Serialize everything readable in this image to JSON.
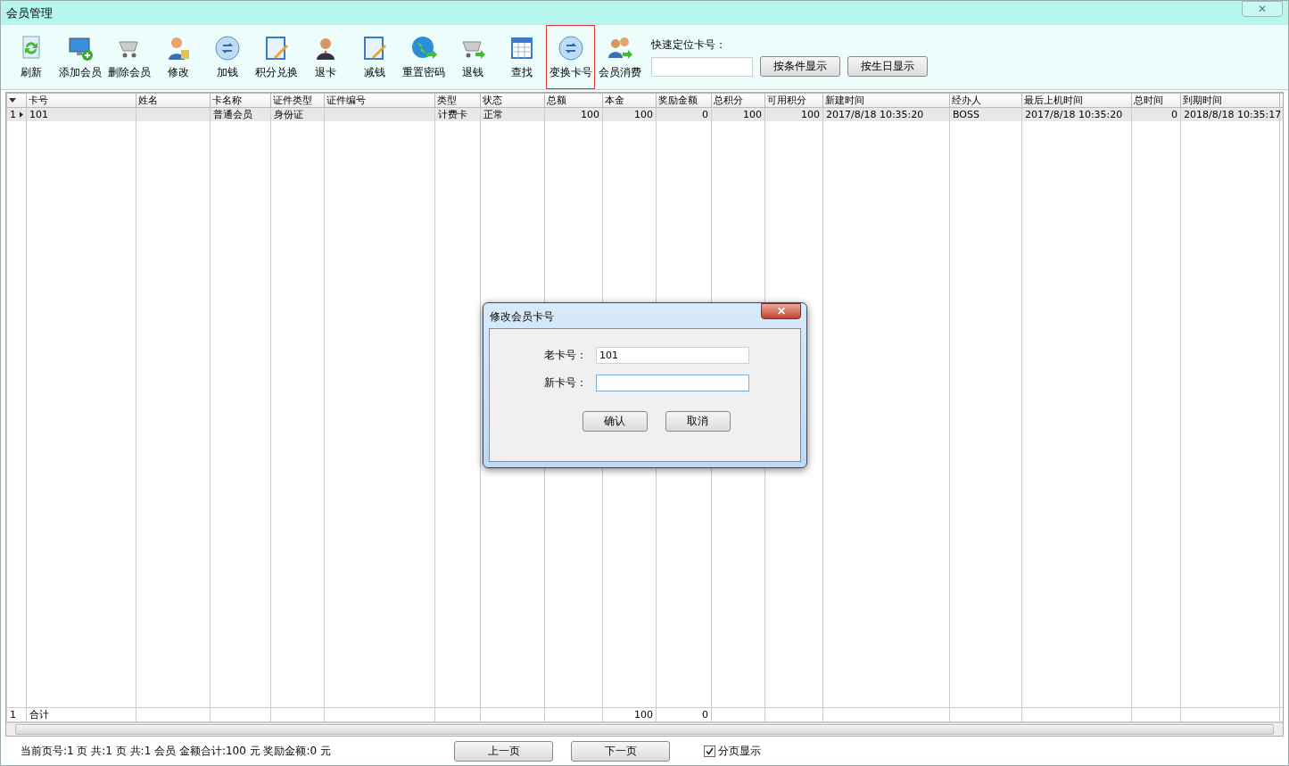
{
  "window": {
    "title": "会员管理",
    "close_label": "✕"
  },
  "toolbar": [
    {
      "label": "刷新",
      "selected": false
    },
    {
      "label": "添加会员",
      "selected": false
    },
    {
      "label": "删除会员",
      "selected": false
    },
    {
      "label": "修改",
      "selected": false
    },
    {
      "label": "加钱",
      "selected": false
    },
    {
      "label": "积分兑换",
      "selected": false
    },
    {
      "label": "退卡",
      "selected": false
    },
    {
      "label": "减钱",
      "selected": false
    },
    {
      "label": "重置密码",
      "selected": false
    },
    {
      "label": "退钱",
      "selected": false
    },
    {
      "label": "查找",
      "selected": false
    },
    {
      "label": "变换卡号",
      "selected": true
    },
    {
      "label": "会员消费",
      "selected": false
    }
  ],
  "quick_locate": {
    "label": "快速定位卡号：",
    "buttons": [
      "按条件显示",
      "按生日显示"
    ]
  },
  "table": {
    "columns": [
      {
        "label": "卡号",
        "numeric": false
      },
      {
        "label": "姓名"
      },
      {
        "label": "卡名称",
        "numeric": false
      },
      {
        "label": "证件类型",
        "numeric": false
      },
      {
        "label": "证件编号"
      },
      {
        "label": "类型",
        "numeric": false
      },
      {
        "label": "状态",
        "numeric": false
      },
      {
        "label": "总额",
        "numeric": true
      },
      {
        "label": "本金",
        "numeric": true
      },
      {
        "label": "奖励金额",
        "numeric": true
      },
      {
        "label": "总积分",
        "numeric": true
      },
      {
        "label": "可用积分",
        "numeric": true
      },
      {
        "label": "新建时间",
        "numeric": false
      },
      {
        "label": "经办人",
        "numeric": false
      },
      {
        "label": "最后上机时间",
        "numeric": false
      },
      {
        "label": "总时间",
        "numeric": true
      },
      {
        "label": "到期时间"
      }
    ],
    "rows": [
      {
        "index": "1",
        "cells": [
          "101",
          "",
          "普通会员",
          "身份证",
          "",
          "计费卡",
          "正常",
          "100",
          "100",
          "0",
          "100",
          "100",
          "2017/8/18 10:35:20",
          "BOSS",
          "2017/8/18 10:35:20",
          "0",
          "2018/8/18 10:35:17"
        ]
      }
    ],
    "total_row": {
      "index": "1",
      "cells": [
        "合计",
        "",
        "",
        "",
        "",
        "",
        "",
        "",
        "100",
        "0",
        "",
        "",
        "",
        "",
        "",
        "",
        ""
      ]
    }
  },
  "status_bar": {
    "summary": "当前页号:1 页 共:1 页 共:1 会员 金额合计:100 元 奖励金额:0 元",
    "prev": "上一页",
    "next": "下一页",
    "paging": {
      "label": "分页显示",
      "checked": true
    }
  },
  "dialog": {
    "title": "修改会员卡号",
    "close_label": "✕",
    "fields": [
      {
        "label": "老卡号：",
        "value": "101"
      },
      {
        "label": "新卡号："
      }
    ],
    "buttons": [
      "确认",
      "取消"
    ]
  }
}
